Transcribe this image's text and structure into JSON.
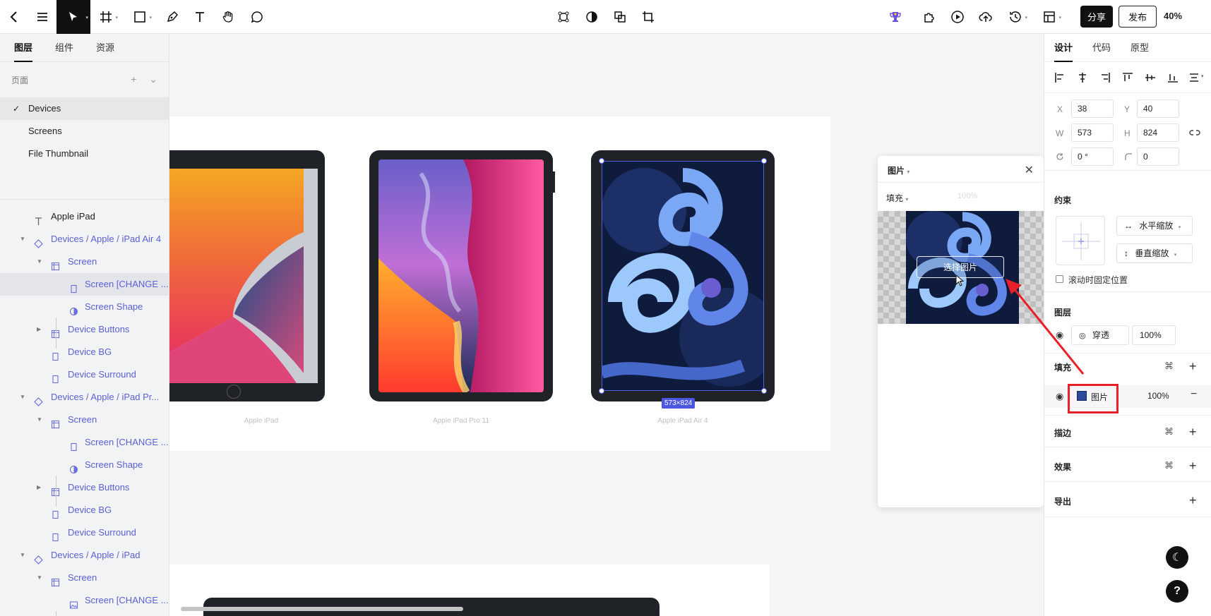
{
  "toolbar": {
    "share_label": "分享",
    "publish_label": "发布",
    "zoom": "40%"
  },
  "left_panel": {
    "tabs": [
      "图层",
      "组件",
      "资源"
    ],
    "pages_label": "页面",
    "pages": [
      "Devices",
      "Screens",
      "File Thumbnail"
    ],
    "layers": [
      {
        "name": "Apple iPad",
        "type": "text"
      },
      {
        "name": "Devices / Apple / iPad Air 4",
        "type": "comp"
      },
      {
        "name": "Screen",
        "type": "frame"
      },
      {
        "name": "Screen [CHANGE ...",
        "type": "rect"
      },
      {
        "name": "Screen Shape",
        "type": "shape"
      },
      {
        "name": "Device Buttons",
        "type": "frame"
      },
      {
        "name": "Device BG",
        "type": "rect"
      },
      {
        "name": "Device Surround",
        "type": "rect"
      },
      {
        "name": "Devices / Apple / iPad Pr...",
        "type": "comp"
      },
      {
        "name": "Screen",
        "type": "frame"
      },
      {
        "name": "Screen [CHANGE ...",
        "type": "rect"
      },
      {
        "name": "Screen Shape",
        "type": "shape"
      },
      {
        "name": "Device Buttons",
        "type": "frame"
      },
      {
        "name": "Device BG",
        "type": "rect"
      },
      {
        "name": "Device Surround",
        "type": "rect"
      },
      {
        "name": "Devices / Apple / iPad",
        "type": "comp"
      },
      {
        "name": "Screen",
        "type": "frame"
      },
      {
        "name": "Screen [CHANGE ...",
        "type": "image"
      }
    ]
  },
  "canvas": {
    "device_labels": [
      "Apple iPad",
      "Apple iPad Pro 11",
      "Apple iPad Air 4"
    ],
    "size_badge": "573×824"
  },
  "image_popup": {
    "title": "图片",
    "fill_label": "填充",
    "opacity": "100%",
    "choose_button": "选择图片"
  },
  "right_panel": {
    "tabs": [
      "设计",
      "代码",
      "原型"
    ],
    "x_label": "X",
    "x_value": "38",
    "y_label": "Y",
    "y_value": "40",
    "w_label": "W",
    "w_value": "573",
    "h_label": "H",
    "h_value": "824",
    "rotation_value": "0 °",
    "radius_value": "0",
    "constraints_title": "约束",
    "horizontal_constraint": "水平缩放",
    "vertical_constraint": "垂直缩放",
    "fix_on_scroll": "滚动时固定位置",
    "layer_title": "图层",
    "blend_mode": "穿透",
    "layer_opacity": "100%",
    "fill_title": "填充",
    "fill_type": "图片",
    "fill_opacity": "100%",
    "stroke_title": "描边",
    "effects_title": "效果",
    "export_title": "导出"
  }
}
